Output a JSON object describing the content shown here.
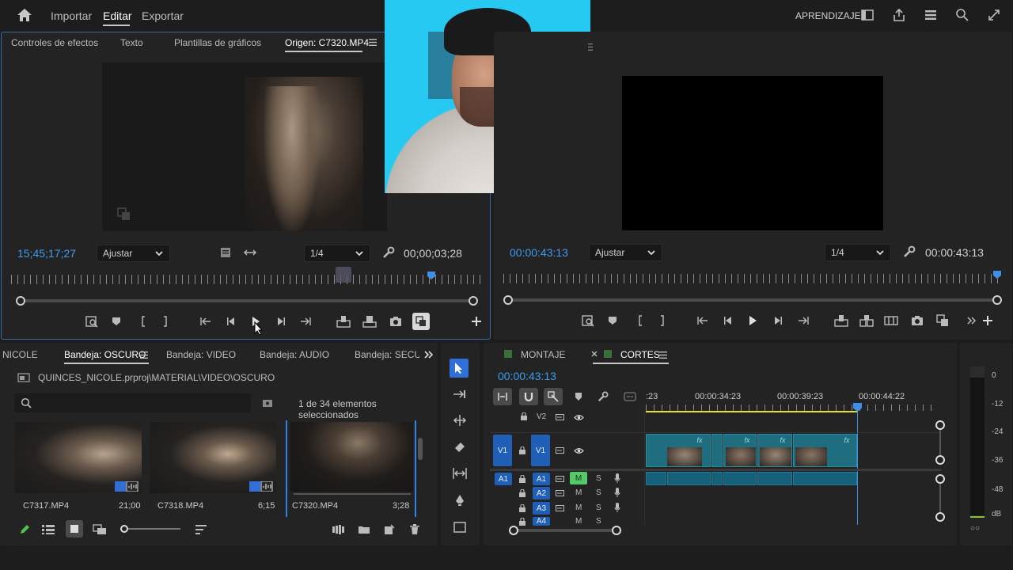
{
  "header": {
    "home_icon": "home-icon",
    "nav": [
      "Importar",
      "Editar",
      "Exportar"
    ],
    "active": "Editar",
    "aprendizaje": "APRENDIZAJE"
  },
  "source": {
    "tabs": [
      "Controles de efectos",
      "Texto",
      "Plantillas de gráficos",
      "Origen: C7320.MP4"
    ],
    "timecode_left": "15;45;17;27",
    "fit": "Ajustar",
    "resolution": "1/4",
    "timecode_right": "00;00;03;28",
    "progress": 0.93
  },
  "program": {
    "timecode_left": "00:00:43:13",
    "fit": "Ajustar",
    "resolution": "1/4",
    "timecode_right": "00:00:43:13",
    "progress": 1.0
  },
  "project": {
    "tabs": [
      "NICOLE",
      "Bandeja: OSCURO",
      "Bandeja: VIDEO",
      "Bandeja: AUDIO",
      "Bandeja: SECUEN"
    ],
    "path": "QUINCES_NICOLE.prproj\\MATERIAL\\VIDEO\\OSCURO",
    "selection": "1 de 34 elementos seleccionados",
    "items": [
      {
        "name": "C7317.MP4",
        "duration": "21;00"
      },
      {
        "name": "C7318.MP4",
        "duration": "6;15"
      },
      {
        "name": "C7320.MP4",
        "duration": "3;28"
      }
    ]
  },
  "timeline": {
    "tabs": [
      "MONTAJE",
      "CORTES"
    ],
    "timecode": "00:00:43:13",
    "ruler": [
      ":23",
      "00:00:34:23",
      "00:00:39:23",
      "00:00:44:22"
    ],
    "tracks": {
      "v2": "V2",
      "v1_src": "V1",
      "v1": "V1",
      "a1_src": "A1",
      "a1": "A1",
      "a2": "A2",
      "a3": "A3",
      "a4": "A4",
      "m": "M",
      "s": "S"
    }
  },
  "meter": {
    "labels": [
      "0",
      "-12",
      "-24",
      "-36",
      "-48",
      "dB"
    ],
    "footer": "○○"
  }
}
